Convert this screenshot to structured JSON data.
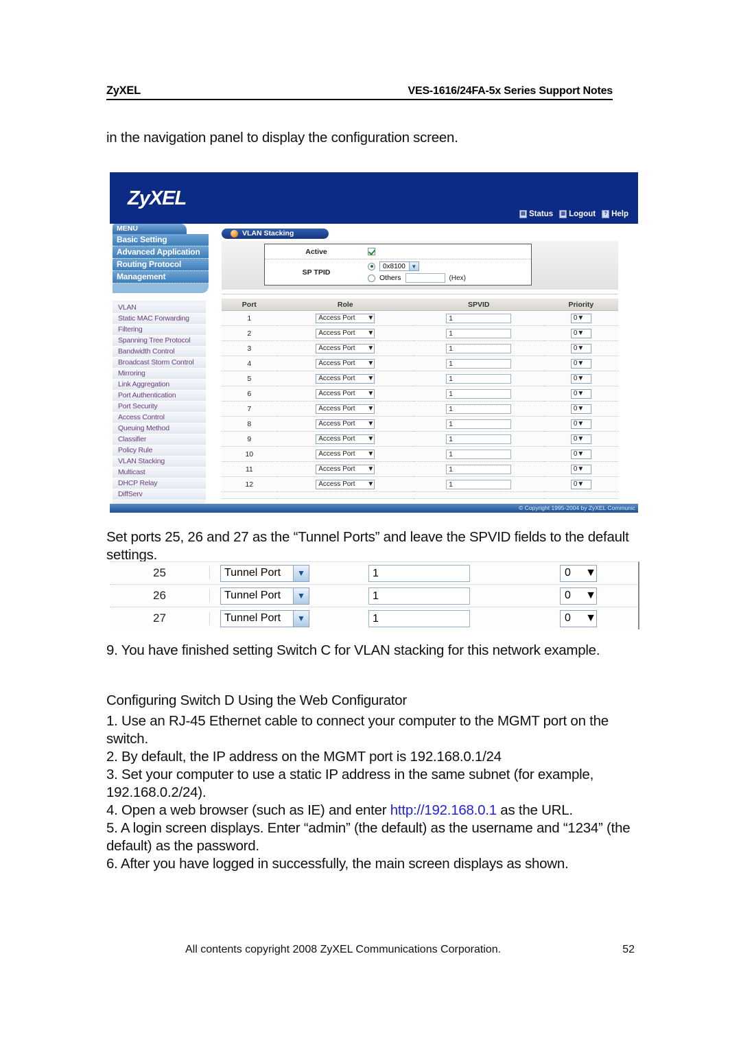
{
  "header": {
    "brand": "ZyXEL",
    "doc_title": "VES-1616/24FA-5x Series Support Notes"
  },
  "intro": {
    "line": "in the navigation panel to display the configuration screen."
  },
  "app_screenshot": {
    "logo": "ZyXEL",
    "top_links": [
      {
        "icon": "status-icon",
        "glyph": "▤",
        "label": "Status"
      },
      {
        "icon": "logout-icon",
        "glyph": "▥",
        "label": "Logout"
      },
      {
        "icon": "help-icon",
        "glyph": "?",
        "label": "Help"
      }
    ],
    "menu": {
      "tab_label": "MENU",
      "main_items": [
        "Basic Setting",
        "Advanced Application",
        "Routing Protocol",
        "Management"
      ],
      "sub_items": [
        "VLAN",
        "Static MAC Forwarding",
        "Filtering",
        "Spanning Tree Protocol",
        "Bandwidth Control",
        "Broadcast Storm Control",
        "Mirroring",
        "Link Aggregation",
        "Port Authentication",
        "Port Security",
        "Access Control",
        "Queuing Method",
        "Classifier",
        "Policy Rule",
        "VLAN Stacking",
        "Multicast",
        "DHCP Relay",
        "DiffServ"
      ]
    },
    "panel": {
      "title": "VLAN Stacking",
      "active_label": "Active",
      "active_checked": true,
      "sp_tpid_label": "SP TPID",
      "tpid_value": "0x8100",
      "others_label": "Others",
      "others_value": "",
      "hex_note": "(Hex)"
    },
    "table": {
      "columns": [
        "Port",
        "Role",
        "SPVID",
        "Priority"
      ],
      "rows": [
        {
          "port": "1",
          "role": "Access Port",
          "spvid": "1",
          "priority": "0"
        },
        {
          "port": "2",
          "role": "Access Port",
          "spvid": "1",
          "priority": "0"
        },
        {
          "port": "3",
          "role": "Access Port",
          "spvid": "1",
          "priority": "0"
        },
        {
          "port": "4",
          "role": "Access Port",
          "spvid": "1",
          "priority": "0"
        },
        {
          "port": "5",
          "role": "Access Port",
          "spvid": "1",
          "priority": "0"
        },
        {
          "port": "6",
          "role": "Access Port",
          "spvid": "1",
          "priority": "0"
        },
        {
          "port": "7",
          "role": "Access Port",
          "spvid": "1",
          "priority": "0"
        },
        {
          "port": "8",
          "role": "Access Port",
          "spvid": "1",
          "priority": "0"
        },
        {
          "port": "9",
          "role": "Access Port",
          "spvid": "1",
          "priority": "0"
        },
        {
          "port": "10",
          "role": "Access Port",
          "spvid": "1",
          "priority": "0"
        },
        {
          "port": "11",
          "role": "Access Port",
          "spvid": "1",
          "priority": "0"
        },
        {
          "port": "12",
          "role": "Access Port",
          "spvid": "1",
          "priority": "0"
        }
      ]
    },
    "footer": "© Copyright 1995-2004 by ZyXEL Communic"
  },
  "tunnel_section": {
    "caption": "Set ports 25, 26 and 27 as the “Tunnel Ports” and leave the SPVID fields to the default settings.",
    "rows": [
      {
        "port": "25",
        "role": "Tunnel Port",
        "spvid": "1",
        "priority": "0"
      },
      {
        "port": "26",
        "role": "Tunnel Port",
        "spvid": "1",
        "priority": "0"
      },
      {
        "port": "27",
        "role": "Tunnel Port",
        "spvid": "1",
        "priority": "0"
      }
    ]
  },
  "step9": "9. You have finished setting Switch C for VLAN stacking for this network example.",
  "switch_d": {
    "heading": "Configuring Switch D Using the Web Configurator",
    "step1": "1. Use an RJ-45 Ethernet cable to connect your computer to the MGMT port on the switch.",
    "step2": "2. By default, the IP address on the MGMT port is 192.168.0.1/24",
    "step3": "3. Set your computer to use a static IP address in the same subnet (for example, 192.168.0.2/24).",
    "step4_pre": "4. Open a web browser (such as IE) and enter ",
    "step4_url": "http://192.168.0.1",
    "step4_post": " as the URL.",
    "step5": "5. A login screen displays. Enter “admin” (the default) as the username and “1234” (the default) as the password.",
    "step6": "6. After you have logged in successfully, the main screen displays as shown."
  },
  "page_footer": {
    "copyright": "All contents copyright 2008 ZyXEL Communications Corporation.",
    "page_number": "52"
  }
}
